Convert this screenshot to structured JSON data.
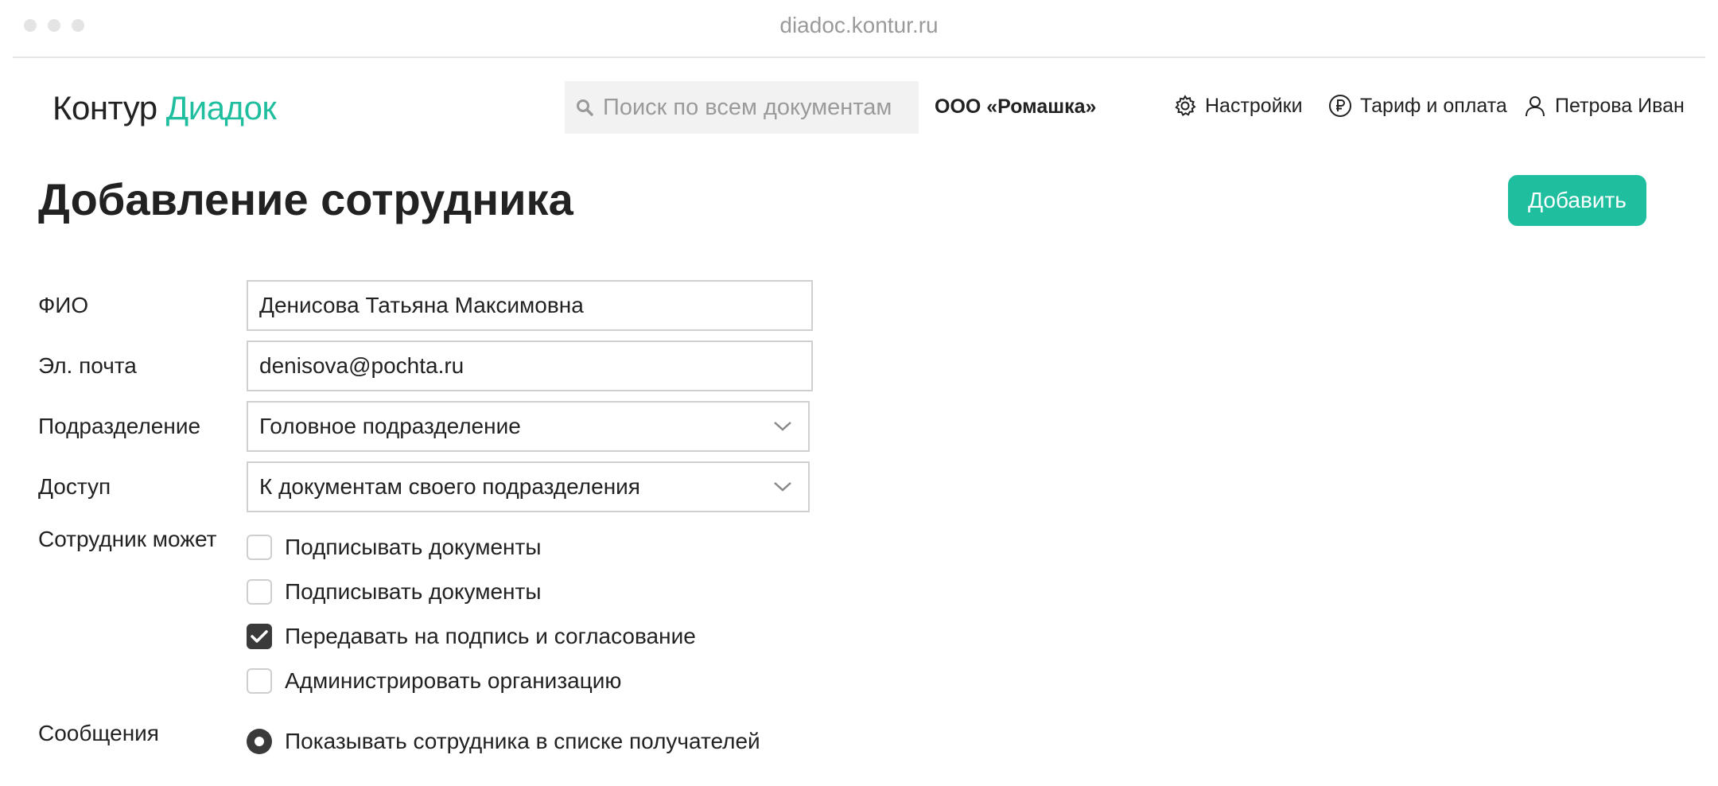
{
  "browser": {
    "url": "diadoc.kontur.ru"
  },
  "header": {
    "logo_part1": "Контур",
    "logo_part2": "Диадок",
    "search_placeholder": "Поиск по всем документам",
    "organization": "ООО «Ромашка»",
    "settings_label": "Настройки",
    "tariff_label": "Тариф и оплата",
    "user_label": "Петрова Иван"
  },
  "page": {
    "title": "Добавление сотрудника",
    "add_button": "Добавить"
  },
  "form": {
    "fio_label": "ФИО",
    "fio_value": "Денисова Татьяна Максимовна",
    "email_label": "Эл. почта",
    "email_value": "denisova@pochta.ru",
    "department_label": "Подразделение",
    "department_value": "Головное подразделение",
    "access_label": "Доступ",
    "access_value": "К документам своего подразделения",
    "permissions_label": "Сотрудник может",
    "permissions": [
      {
        "label": "Подписывать документы",
        "checked": false
      },
      {
        "label": "Подписывать документы",
        "checked": false
      },
      {
        "label": "Передавать на подпись и согласование",
        "checked": true
      },
      {
        "label": "Администрировать организацию",
        "checked": false
      }
    ],
    "messages_label": "Сообщения",
    "messages_option": "Показывать сотрудника в списке получателей",
    "messages_selected": true
  },
  "colors": {
    "accent": "#1fbe9f",
    "text": "#222222",
    "border": "#d0d0d0"
  }
}
